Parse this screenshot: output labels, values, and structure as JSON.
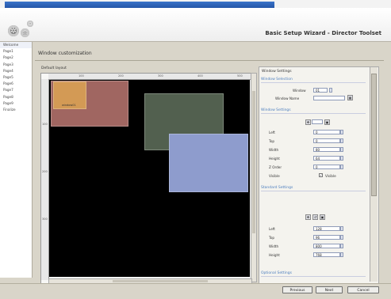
{
  "wizard_title": "Basic Setup Wizard - Director Toolset",
  "sidebar": {
    "items": [
      "Welcome",
      "Page1",
      "Page2",
      "Page3",
      "Page4",
      "Page5",
      "Page6",
      "Page7",
      "Page8",
      "Page9",
      "Finalize"
    ]
  },
  "main": {
    "title": "Window customization",
    "layout_label": "Default layout",
    "ruler_ticks_x": [
      "100",
      "200",
      "300",
      "400",
      "500"
    ],
    "ruler_ticks_y": [
      "100",
      "200",
      "300"
    ],
    "sample_window_label": "window01"
  },
  "panel": {
    "title": "Window Settings",
    "window_selection": {
      "section": "Window Selection",
      "window_label": "Window",
      "window_value": "01",
      "window_name_label": "Window Name",
      "window_name_value": ""
    },
    "window_settings": {
      "section": "Window Settings",
      "fields": [
        {
          "label": "Left",
          "value": "0"
        },
        {
          "label": "Top",
          "value": "0"
        },
        {
          "label": "Width",
          "value": "80"
        },
        {
          "label": "Height",
          "value": "64"
        },
        {
          "label": "Z Order",
          "value": "0"
        }
      ],
      "visible_label": "Visible",
      "visible_checkbox_label": "Visible"
    },
    "standard_settings": {
      "section": "Standard Settings",
      "fields": [
        {
          "label": "Left",
          "value": "128"
        },
        {
          "label": "Top",
          "value": "96"
        },
        {
          "label": "Width",
          "value": "800"
        },
        {
          "label": "Height",
          "value": "768"
        }
      ]
    },
    "optional_section": "Optional Settings"
  },
  "buttons": {
    "previous": "Previous",
    "next": "Next",
    "cancel": "Cancel"
  }
}
